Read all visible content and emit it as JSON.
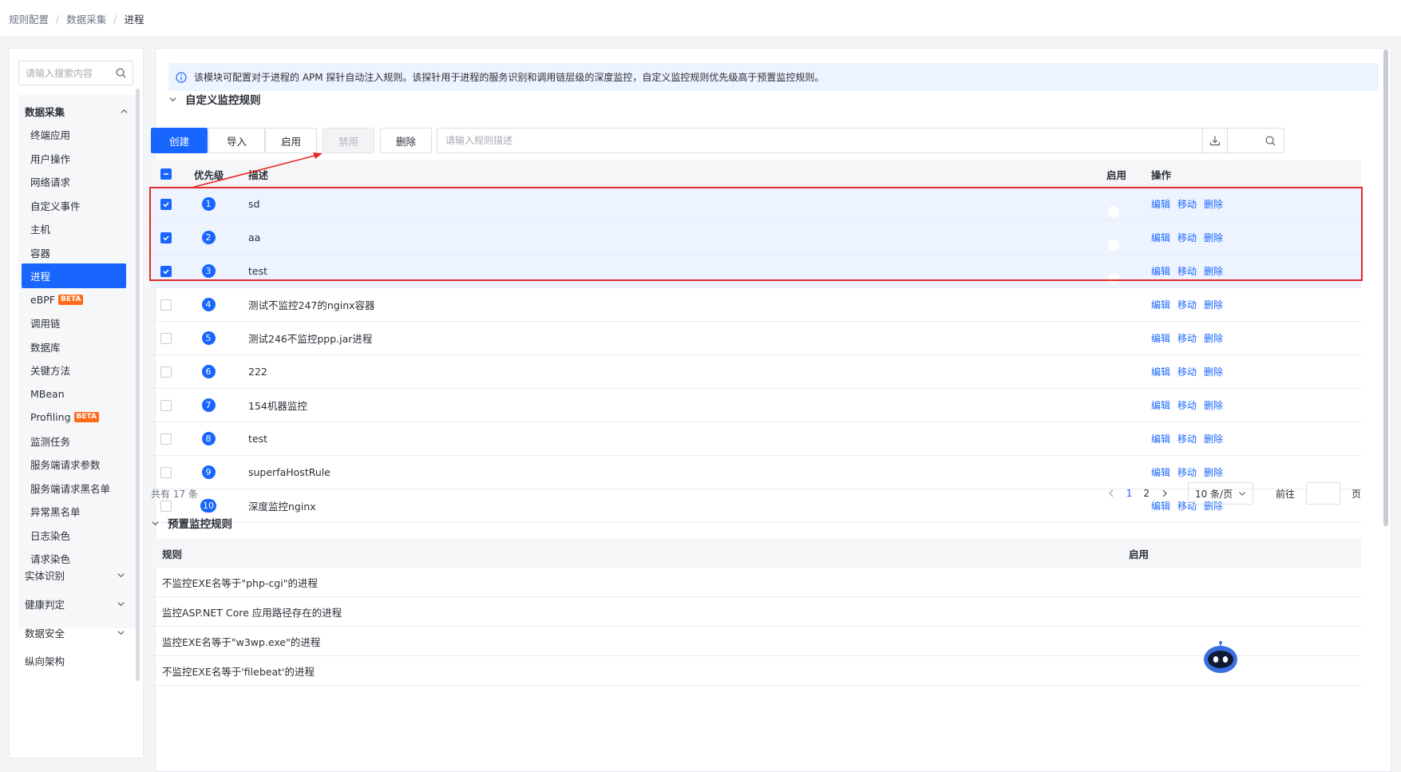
{
  "breadcrumb": [
    "规则配置",
    "数据采集",
    "进程"
  ],
  "sidebar": {
    "search_placeholder": "请输入搜索内容",
    "group_title": "数据采集",
    "items": [
      {
        "label": "终端应用"
      },
      {
        "label": "用户操作"
      },
      {
        "label": "网络请求"
      },
      {
        "label": "自定义事件"
      },
      {
        "label": "主机"
      },
      {
        "label": "容器"
      },
      {
        "label": "进程",
        "active": true
      },
      {
        "label": "eBPF",
        "badge": "BETA"
      },
      {
        "label": "调用链"
      },
      {
        "label": "数据库"
      },
      {
        "label": "关键方法"
      },
      {
        "label": "MBean"
      },
      {
        "label": "Profiling",
        "badge": "BETA"
      },
      {
        "label": "监测任务"
      },
      {
        "label": "服务端请求参数"
      },
      {
        "label": "服务端请求黑名单"
      },
      {
        "label": "异常黑名单"
      },
      {
        "label": "日志染色"
      },
      {
        "label": "请求染色"
      }
    ],
    "categories": [
      "实体识别",
      "健康判定",
      "数据安全",
      "纵向架构"
    ]
  },
  "info_text": "该模块可配置对于进程的 APM 探针自动注入规则。该探针用于进程的服务识别和调用链层级的深度监控，自定义监控规则优先级高于预置监控规则。",
  "custom_section": {
    "title": "自定义监控规则",
    "buttons": {
      "create": "创建",
      "import": "导入",
      "enable": "启用",
      "disable": "禁用",
      "delete": "删除"
    },
    "filter_placeholder": "请输入规则描述",
    "columns": {
      "priority": "优先级",
      "desc": "描述",
      "enabled": "启用",
      "actions": "操作"
    },
    "action_labels": {
      "edit": "编辑",
      "move": "移动",
      "delete": "删除"
    },
    "rows": [
      {
        "priority": "1",
        "desc": "sd",
        "enabled": false,
        "selected": true
      },
      {
        "priority": "2",
        "desc": "aa",
        "enabled": false,
        "selected": true
      },
      {
        "priority": "3",
        "desc": "test",
        "enabled": false,
        "selected": true
      },
      {
        "priority": "4",
        "desc": "测试不监控247的nginx容器",
        "enabled": false,
        "selected": false
      },
      {
        "priority": "5",
        "desc": "测试246不监控ppp.jar进程",
        "enabled": false,
        "selected": false
      },
      {
        "priority": "6",
        "desc": "222",
        "enabled": false,
        "selected": false
      },
      {
        "priority": "7",
        "desc": "154机器监控",
        "enabled": false,
        "selected": false
      },
      {
        "priority": "8",
        "desc": "test",
        "enabled": false,
        "selected": false
      },
      {
        "priority": "9",
        "desc": "superfaHostRule",
        "enabled": true,
        "selected": false
      },
      {
        "priority": "10",
        "desc": "深度监控nginx",
        "enabled": false,
        "selected": false
      }
    ],
    "pagination": {
      "total": "共有 17 条",
      "pages": [
        "1",
        "2"
      ],
      "current_page": "1",
      "page_size": "10 条/页",
      "goto_label": "前往",
      "page_suffix": "页"
    }
  },
  "preset_section": {
    "title": "预置监控规则",
    "columns": {
      "rule": "规则",
      "enabled": "启用"
    },
    "rows": [
      {
        "rule": "不监控EXE名等于\"php-cgi\"的进程",
        "enabled": true
      },
      {
        "rule": "监控ASP.NET Core 应用路径存在的进程",
        "enabled": true
      },
      {
        "rule": "监控EXE名等于\"w3wp.exe\"的进程",
        "enabled": true
      },
      {
        "rule": "不监控EXE名等于'filebeat'的进程",
        "enabled": true
      }
    ]
  },
  "colors": {
    "primary": "#1966ff",
    "highlight_border": "#e52a2a",
    "beta": "#ff6a1a"
  }
}
